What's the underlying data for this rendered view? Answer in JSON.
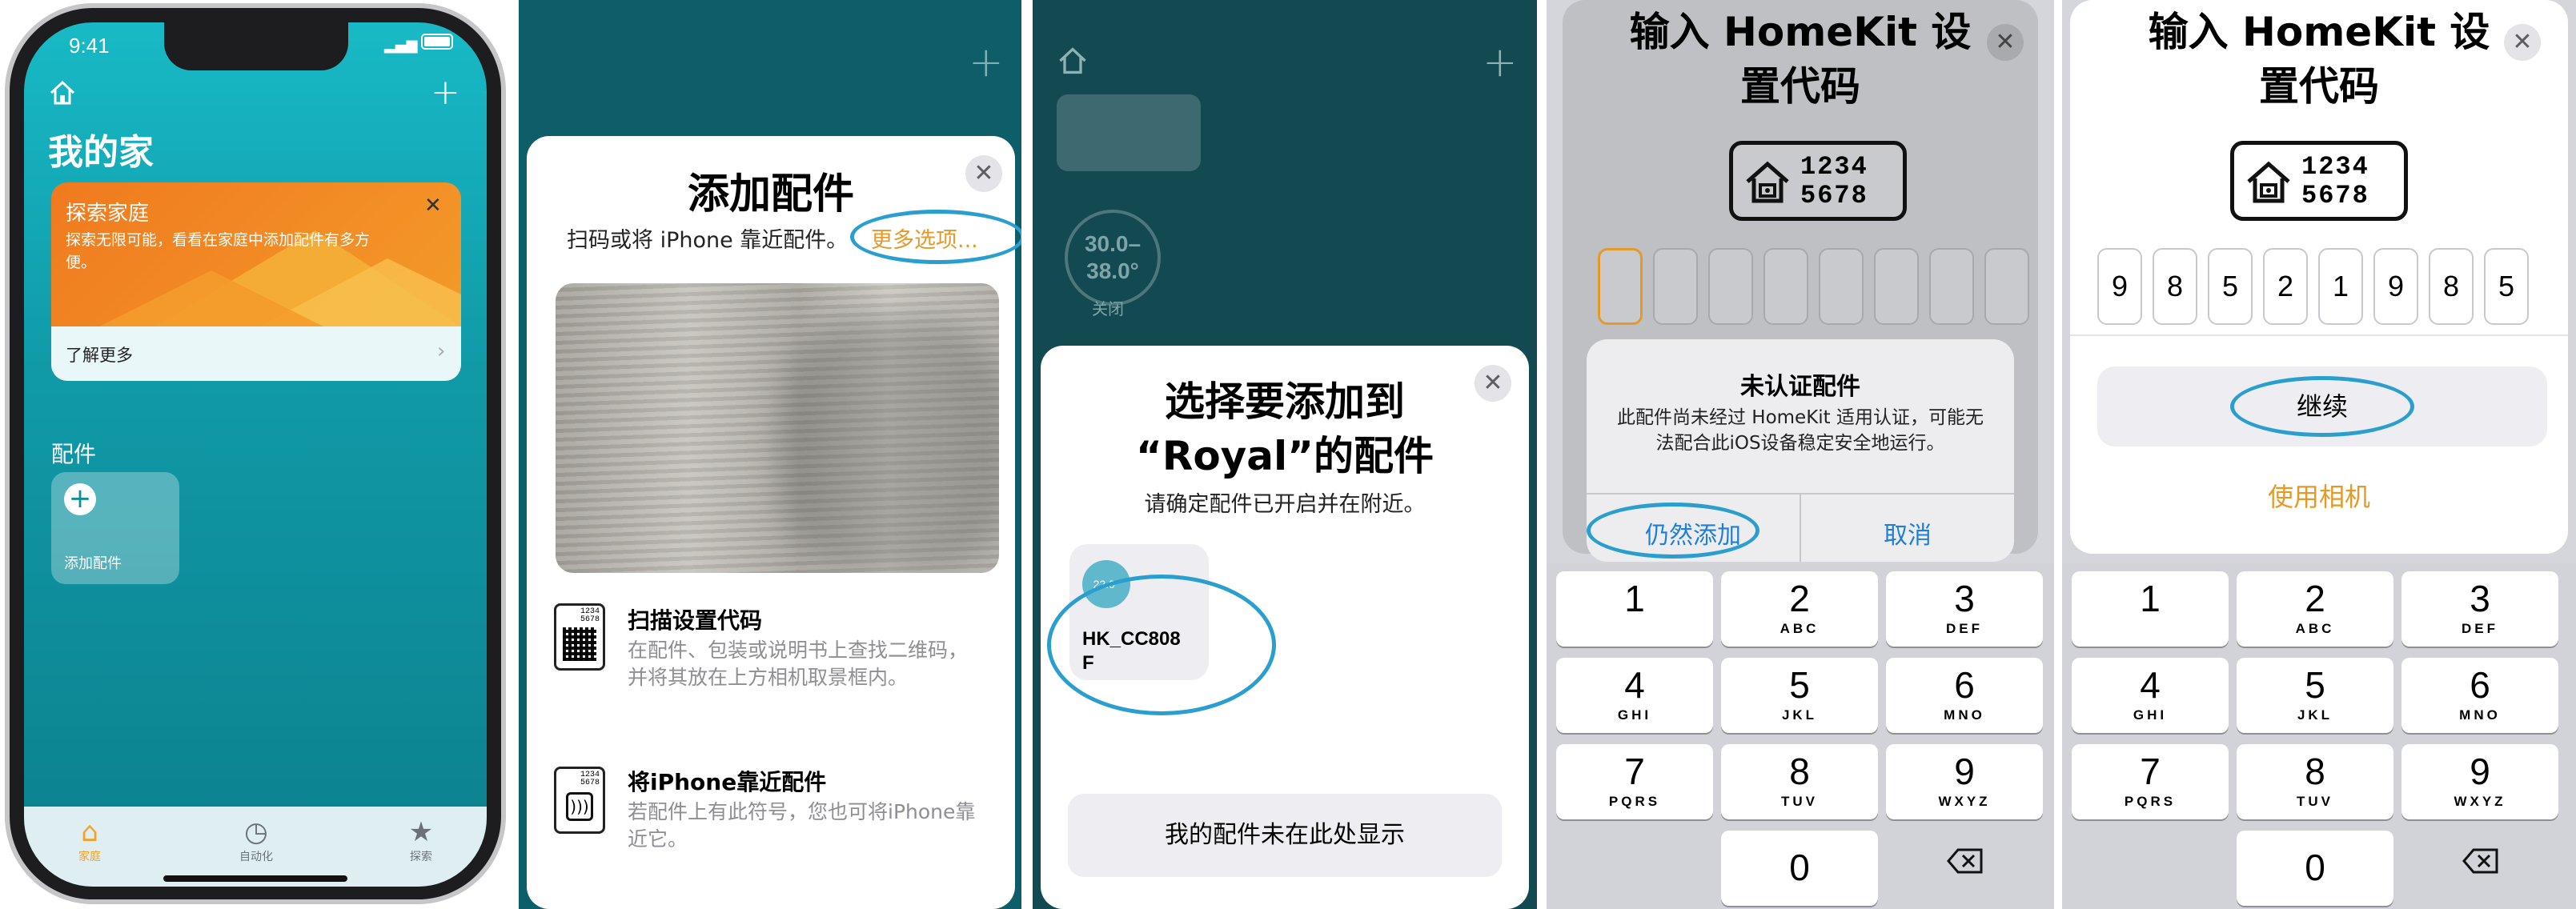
{
  "panel1": {
    "time": "9:41",
    "home_title": "我的家",
    "explore_card": {
      "title": "探索家庭",
      "body": "探索无限可能，看看在家庭中添加配件有多方便。",
      "learn_more": "了解更多"
    },
    "section_accessories": "配件",
    "add_tile_label": "添加配件",
    "tabs": [
      {
        "label": "家庭",
        "active": true
      },
      {
        "label": "自动化",
        "active": false
      },
      {
        "label": "探索",
        "active": false
      }
    ],
    "colors": {
      "accent": "#f0a22b",
      "tile_bg": "#17b3c1"
    }
  },
  "panel2": {
    "title": "添加配件",
    "subtitle": "扫码或将 iPhone 靠近配件。",
    "more_options": "更多选项...",
    "option1_title": "扫描设置代码",
    "option1_desc": "在配件、包装或说明书上查找二维码，并将其放在上方相机取景框内。",
    "qr_code_text": "1234\n5678",
    "option2_title": "将iPhone靠近配件",
    "option2_desc": "若配件上有此符号，您也可将iPhone靠近它。"
  },
  "panel3": {
    "bg_temp": "30.0–\n38.0°",
    "bg_off": "关闭",
    "title_line1": "选择要添加到",
    "title_line2": "“Royal”的配件",
    "subtitle": "请确定配件已开启并在附近。",
    "device_temp": "22.0°",
    "device_name": "HK_CC808\nF",
    "not_shown_button": "我的配件未在此处显示"
  },
  "panel4": {
    "title": "输入 HomeKit 设\n置代码",
    "code_line1": "1234",
    "code_line2": "5678",
    "alert_title": "未认证配件",
    "alert_body": "此配件尚未经过 HomeKit 适用认证，可能无法配合此iOS设备稳定安全地运行。",
    "alert_add_anyway": "仍然添加",
    "alert_cancel": "取消"
  },
  "panel5": {
    "title": "输入 HomeKit 设\n置代码",
    "code_line1": "1234",
    "code_line2": "5678",
    "digits": [
      "9",
      "8",
      "5",
      "2",
      "1",
      "9",
      "8",
      "5"
    ],
    "continue_button": "继续",
    "use_camera": "使用相机"
  },
  "keypad": [
    {
      "num": "1",
      "letters": ""
    },
    {
      "num": "2",
      "letters": "ABC"
    },
    {
      "num": "3",
      "letters": "DEF"
    },
    {
      "num": "4",
      "letters": "GHI"
    },
    {
      "num": "5",
      "letters": "JKL"
    },
    {
      "num": "6",
      "letters": "MNO"
    },
    {
      "num": "7",
      "letters": "PQRS"
    },
    {
      "num": "8",
      "letters": "TUV"
    },
    {
      "num": "9",
      "letters": "WXYZ"
    },
    {
      "num": "0",
      "letters": ""
    }
  ]
}
